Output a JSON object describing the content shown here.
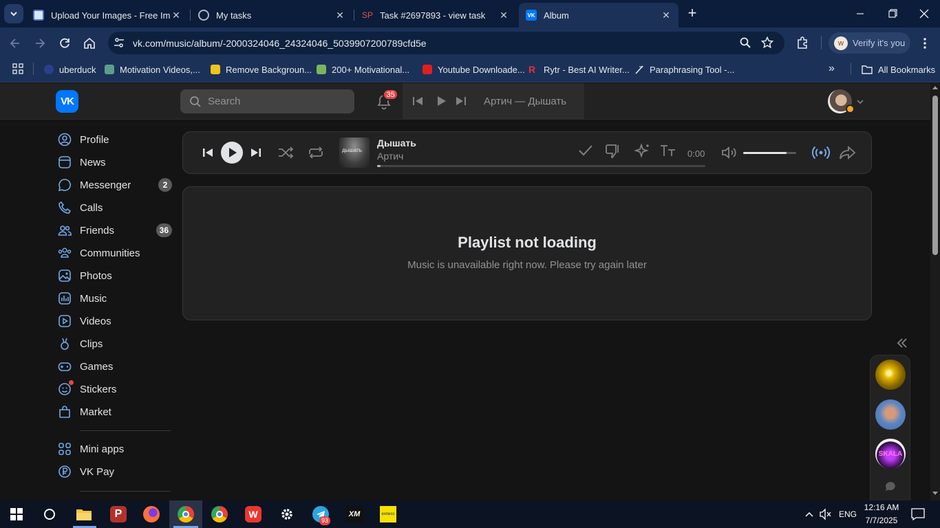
{
  "browser": {
    "tabs": [
      {
        "title": "Upload Your Images - Free Imag"
      },
      {
        "title": "My tasks"
      },
      {
        "title": "Task #2697893 - view task"
      },
      {
        "title": "Album"
      }
    ],
    "url": "vk.com/music/album/-2000324046_24324046_5039907200789cfd5e",
    "profile_button": "Verify it's you",
    "profile_avatar_letter": "w",
    "bookmarks": [
      "uberduck",
      "Motivation Videos,...",
      "Remove Backgroun...",
      "200+ Motivational...",
      "Youtube Downloade...",
      "Rytr - Best AI Writer...",
      "Paraphrasing Tool -..."
    ],
    "all_bookmarks": "All Bookmarks"
  },
  "vk": {
    "logo": "VK",
    "search_placeholder": "Search",
    "notifications_count": "35",
    "header_track": "Артич — Дышать",
    "nav": [
      {
        "label": "Profile",
        "icon": "profile-icon"
      },
      {
        "label": "News",
        "icon": "news-icon"
      },
      {
        "label": "Messenger",
        "icon": "messenger-icon",
        "count": "2"
      },
      {
        "label": "Calls",
        "icon": "calls-icon"
      },
      {
        "label": "Friends",
        "icon": "friends-icon",
        "count": "36"
      },
      {
        "label": "Communities",
        "icon": "communities-icon"
      },
      {
        "label": "Photos",
        "icon": "photos-icon"
      },
      {
        "label": "Music",
        "icon": "music-icon"
      },
      {
        "label": "Videos",
        "icon": "videos-icon"
      },
      {
        "label": "Clips",
        "icon": "clips-icon"
      },
      {
        "label": "Games",
        "icon": "games-icon"
      },
      {
        "label": "Stickers",
        "icon": "stickers-icon"
      },
      {
        "label": "Market",
        "icon": "market-icon"
      }
    ],
    "nav2": [
      {
        "label": "Mini apps",
        "icon": "mini-apps-icon"
      },
      {
        "label": "VK Pay",
        "icon": "vk-pay-icon"
      }
    ],
    "player": {
      "cover_text": "дышать",
      "title": "Дышать",
      "artist": "Артич",
      "time": "0:00",
      "progress": 0.01,
      "volume": 0.82
    },
    "error": {
      "title": "Playlist not loading",
      "message": "Music is unavailable right now. Please try again later"
    },
    "right_panel": {
      "chat3_label": "SKALA"
    }
  },
  "taskbar": {
    "telegram_badge": "93",
    "xm_label": "XM",
    "exness_label": "exness",
    "lang": "ENG",
    "time": "12:16 AM",
    "date": "7/7/2025"
  },
  "colors": {
    "vk_blue": "#0077ff",
    "accent_light": "#71aaeb",
    "badge_red": "#e64646",
    "tab_bg": "#0b1d3a",
    "toolbar_bg": "#1b3158"
  }
}
